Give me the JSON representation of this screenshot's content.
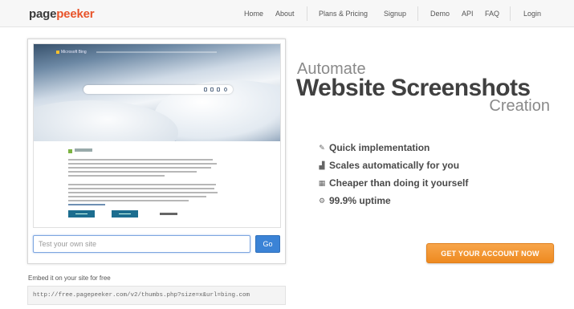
{
  "brand": {
    "part1": "page",
    "part2": "peeker",
    "colors": {
      "dark": "#3a3a3a",
      "accent": "#e8542a"
    }
  },
  "nav": {
    "home": "Home",
    "about": "About",
    "plans": "Plans & Pricing",
    "signup": "Signup",
    "demo": "Demo",
    "api": "API",
    "faq": "FAQ",
    "login": "Login"
  },
  "preview": {
    "site_name": "Microsoft Bing",
    "url_placeholder": "Test your own site",
    "go_label": "Go"
  },
  "embed": {
    "label": "Embed it on your site for free",
    "code": "http://free.pagepeeker.com/v2/thumbs.php?size=x&url=bing.com"
  },
  "hero": {
    "line1": "Automate",
    "line2": "Website Screenshots",
    "line3": "Creation"
  },
  "features": [
    {
      "icon": "pencil-icon",
      "glyph": "✎",
      "text": "Quick implementation"
    },
    {
      "icon": "bar-chart-icon",
      "glyph": "▟",
      "text": "Scales automatically for you"
    },
    {
      "icon": "grid-icon",
      "glyph": "▦",
      "text": "Cheaper than doing it yourself"
    },
    {
      "icon": "gear-icon",
      "glyph": "⚙",
      "text": "99.9% uptime"
    }
  ],
  "cta": {
    "label": "GET YOUR ACCOUNT NOW",
    "color": "#f0922e"
  }
}
